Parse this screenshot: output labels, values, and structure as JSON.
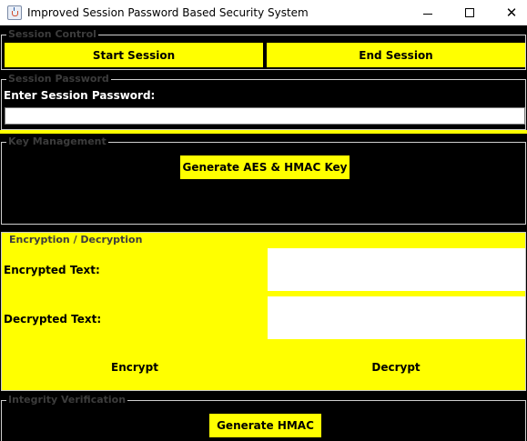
{
  "window": {
    "title": "Improved Session Password Based Security System",
    "controls": {
      "minimize": "minimize-icon",
      "maximize": "maximize-icon",
      "close": "close-icon"
    }
  },
  "session_control": {
    "title": "Session Control",
    "start_label": "Start Session",
    "end_label": "End Session"
  },
  "session_password": {
    "title": "Session Password",
    "prompt": "Enter Session Password:",
    "value": ""
  },
  "key_management": {
    "title": "Key Management",
    "generate_label": "Generate AES & HMAC Key"
  },
  "encryption": {
    "title": "Encryption / Decryption",
    "encrypted_label": "Encrypted Text:",
    "encrypted_value": "",
    "decrypted_label": "Decrypted Text:",
    "decrypted_value": "",
    "encrypt_label": "Encrypt",
    "decrypt_label": "Decrypt"
  },
  "integrity": {
    "title": "Integrity Verification",
    "generate_hmac_label": "Generate HMAC"
  },
  "colors": {
    "accent": "#ffff00",
    "background": "#000000",
    "field": "#ffffff"
  }
}
